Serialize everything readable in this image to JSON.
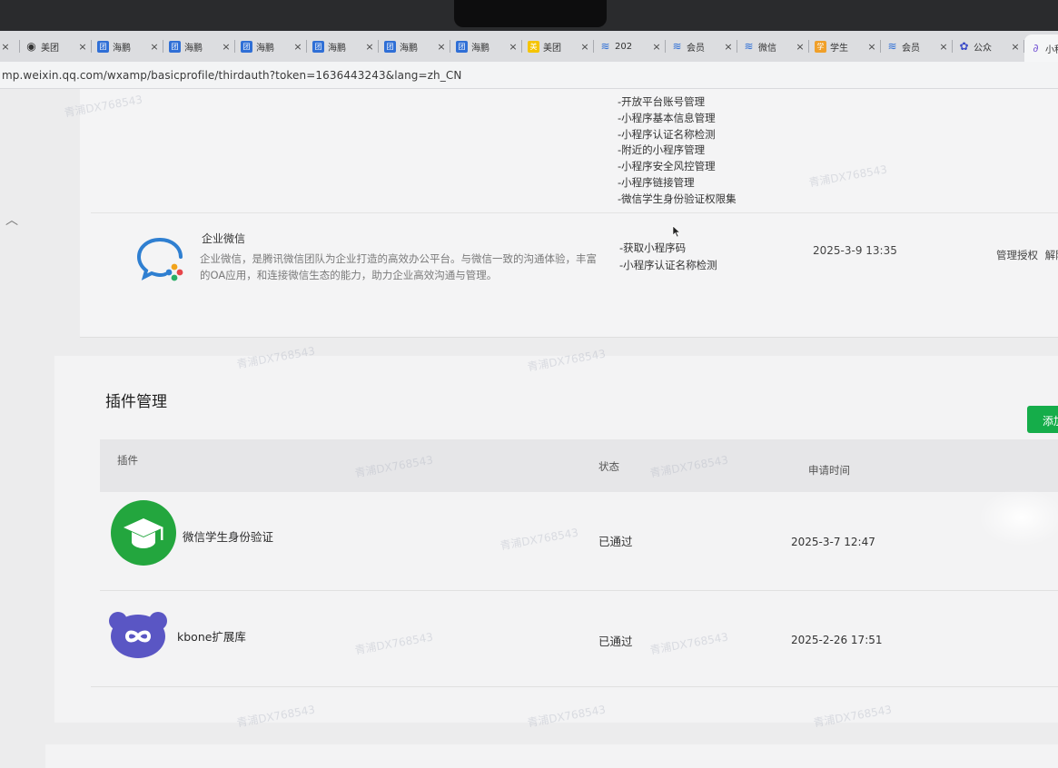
{
  "browser": {
    "tabs": [
      {
        "label": "",
        "icon": "close-icon",
        "color": "#444"
      },
      {
        "label": "美团",
        "icon": "globe-icon",
        "color": "#333"
      },
      {
        "label": "海鹏",
        "icon": "team-icon",
        "color": "#2f6fd6"
      },
      {
        "label": "海鹏",
        "icon": "team-icon",
        "color": "#2f6fd6"
      },
      {
        "label": "海鹏",
        "icon": "team-icon",
        "color": "#2f6fd6"
      },
      {
        "label": "海鹏",
        "icon": "team-icon",
        "color": "#2f6fd6"
      },
      {
        "label": "海鹏",
        "icon": "team-icon",
        "color": "#2f6fd6"
      },
      {
        "label": "海鹏",
        "icon": "team-icon",
        "color": "#2f6fd6"
      },
      {
        "label": "美团",
        "icon": "meituan-icon",
        "color": "#f5c400"
      },
      {
        "label": "202",
        "icon": "wave-icon",
        "color": "#2f6fd6"
      },
      {
        "label": "会员",
        "icon": "wave-icon",
        "color": "#2f6fd6"
      },
      {
        "label": "微信",
        "icon": "wave-icon",
        "color": "#2f6fd6"
      },
      {
        "label": "学生",
        "icon": "student-icon",
        "color": "#f0a02a"
      },
      {
        "label": "会员",
        "icon": "wave-icon",
        "color": "#2f6fd6"
      },
      {
        "label": "公众",
        "icon": "paw-icon",
        "color": "#3b4bc8"
      },
      {
        "label": "小程",
        "icon": "miniprogram-icon",
        "color": "#7b5cd6",
        "active": true
      }
    ],
    "url": "mp.weixin.qq.com/wxamp/basicprofile/thirdauth?token=1636443243&lang=zh_CN"
  },
  "third_party": {
    "permissions_top": [
      "-开放平台账号管理",
      "-小程序基本信息管理",
      "-小程序认证名称检测",
      "-附近的小程序管理",
      "-小程序安全风控管理",
      "-小程序链接管理",
      "-微信学生身份验证权限集"
    ],
    "wework": {
      "name": "企业微信",
      "description": "企业微信，是腾讯微信团队为企业打造的高效办公平台。与微信一致的沟通体验，丰富的OA应用，和连接微信生态的能力，助力企业高效沟通与管理。",
      "permissions": [
        "-获取小程序码",
        "-小程序认证名称检测"
      ],
      "time": "2025-3-9 13:35",
      "action_manage": "管理授权",
      "action_revoke": "解除"
    }
  },
  "plugins": {
    "title": "插件管理",
    "add_button": "添加",
    "columns": {
      "plugin": "插件",
      "status": "状态",
      "time": "申请时间"
    },
    "rows": [
      {
        "name": "微信学生身份验证",
        "status": "已通过",
        "time": "2025-3-7 12:47",
        "icon": "graduation-cap-icon"
      },
      {
        "name": "kbone扩展库",
        "status": "已通过",
        "time": "2025-2-26 17:51",
        "icon": "kbone-infinity-icon"
      }
    ]
  },
  "watermark": "青浦DX768543",
  "colors": {
    "accent_green": "#15ad4a",
    "student_green": "#23a63e",
    "kbone_purple": "#5a56c4"
  }
}
